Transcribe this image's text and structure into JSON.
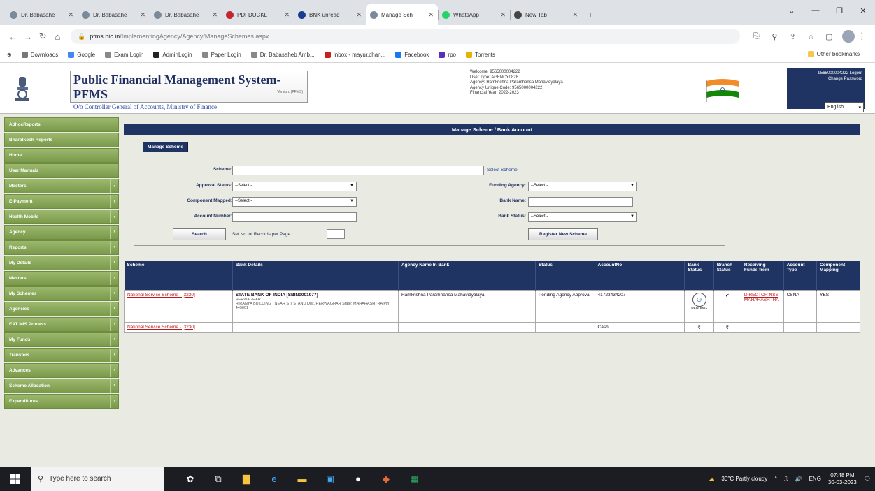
{
  "browser": {
    "tabs": [
      {
        "label": "Dr. Babasahe",
        "active": false
      },
      {
        "label": "Dr. Babasahe",
        "active": false
      },
      {
        "label": "Dr. Babasahe",
        "active": false
      },
      {
        "label": "PDFDUCKL",
        "active": false
      },
      {
        "label": "BNK unread",
        "active": false
      },
      {
        "label": "Manage Sch",
        "active": true
      },
      {
        "label": "WhatsApp",
        "active": false
      },
      {
        "label": "New Tab",
        "active": false
      }
    ],
    "url_host": "pfms.nic.in",
    "url_path": "/ImplementingAgency/Agency/ManageSchemes.aspx",
    "bookmarks": [
      "Downloads",
      "Google",
      "Exam Login",
      "AdminLogin",
      "Paper Login",
      "Dr. Babasaheb Amb...",
      "Inbox - mayur.chan...",
      "Facebook",
      "rpo",
      "Torrents"
    ],
    "other_bookmarks": "Other bookmarks"
  },
  "header": {
    "title": "Public Financial Management System-PFMS",
    "subtitle": "O/o Controller General of Accounts, Ministry of Finance",
    "tag": "Version: (PFMS)",
    "user_lines": [
      "Welcome: 9565000004222",
      "User Type: AGENCY0828",
      "Agency: Ramkrishna Paramhansa Mahavidyalaya",
      "Agency Unique Code: 9565000004222",
      "Financial Year: 2022-2023"
    ],
    "top_links": [
      "9565000004222 Logout",
      "Change Password"
    ],
    "language": "English"
  },
  "sidebar": {
    "items": [
      {
        "label": "AdhocReports",
        "arrow": false
      },
      {
        "label": "Bharatkosh Reports",
        "arrow": false
      },
      {
        "label": "Home",
        "arrow": false
      },
      {
        "label": "User Manuals",
        "arrow": false
      },
      {
        "label": "Masters",
        "arrow": true
      },
      {
        "label": "E-Payment",
        "arrow": true
      },
      {
        "label": "Health Mobile",
        "arrow": true
      },
      {
        "label": "Agency",
        "arrow": true
      },
      {
        "label": "Reports",
        "arrow": true
      },
      {
        "label": "My Details",
        "arrow": true
      },
      {
        "label": "Masters",
        "arrow": true
      },
      {
        "label": "My Schemes",
        "arrow": true
      },
      {
        "label": "Agencies",
        "arrow": true
      },
      {
        "label": "EAT MIS Process",
        "arrow": true
      },
      {
        "label": "My Funds",
        "arrow": true
      },
      {
        "label": "Transfers",
        "arrow": true
      },
      {
        "label": "Advances",
        "arrow": true
      },
      {
        "label": "Scheme Allocation",
        "arrow": true
      },
      {
        "label": "Expenditures",
        "arrow": true
      }
    ]
  },
  "main": {
    "banner": "Manage Scheme / Bank Account",
    "legend": "Manage Scheme",
    "form": {
      "scheme_label": "Scheme:",
      "scheme_value": "",
      "select_scheme_link": "Select Scheme",
      "approval_status_label": "Approval Status:",
      "approval_status_value": "--Select--",
      "funding_agency_label": "Funding Agency:",
      "funding_agency_value": "--Select--",
      "component_mapped_label": "Component Mapped:",
      "component_mapped_value": "--Select--",
      "bank_name_label": "Bank Name:",
      "bank_name_value": "",
      "account_number_label": "Account Number:",
      "account_number_value": "",
      "bank_status_label": "Bank Status:",
      "bank_status_value": "--Select--",
      "search_button": "Search",
      "records_label": "Set No. of Records per Page:",
      "records_value": "",
      "register_button": "Register New Scheme"
    },
    "table": {
      "headers": [
        "Scheme",
        "Bank Details",
        "Agency Name In Bank",
        "Status",
        "AccountNo",
        "Bank Status",
        "Branch Status",
        "Receiving Funds from",
        "Account Type",
        "Component Mapping"
      ],
      "rows": [
        {
          "scheme": "National Service Scheme - [3230]",
          "bank_name": "STATE BANK OF INDIA [SBIN0001977]",
          "bank_line2": "HERWAGHAR",
          "bank_line3": "HIRANYA BUILDING , NEAR S T STAND Dist. HERWAGHAR State: MAHARASHTRA Pin: 445001",
          "agency_name": "Ramkrishna Paramhansa Mahavidyalaya",
          "status": "Pending Agency Approval",
          "account_no": "41723434207",
          "bank_status": "PENDING",
          "branch_status": "✔",
          "receiving": "DIRECTOR NSS MAHARASHTRA",
          "account_type": "CSNA",
          "component": "YES"
        },
        {
          "scheme": "National Service Scheme - [3230]",
          "bank_name": "",
          "bank_line2": "",
          "bank_line3": "",
          "agency_name": "",
          "status": "",
          "account_no": "Cash",
          "bank_status": "₹",
          "branch_status": "₹",
          "receiving": "",
          "account_type": "",
          "component": ""
        }
      ]
    }
  },
  "taskbar": {
    "search_placeholder": "Type here to search",
    "weather": "30°C Partly cloudy",
    "lang": "ENG",
    "time": "07:48 PM",
    "date": "30-03-2023"
  }
}
